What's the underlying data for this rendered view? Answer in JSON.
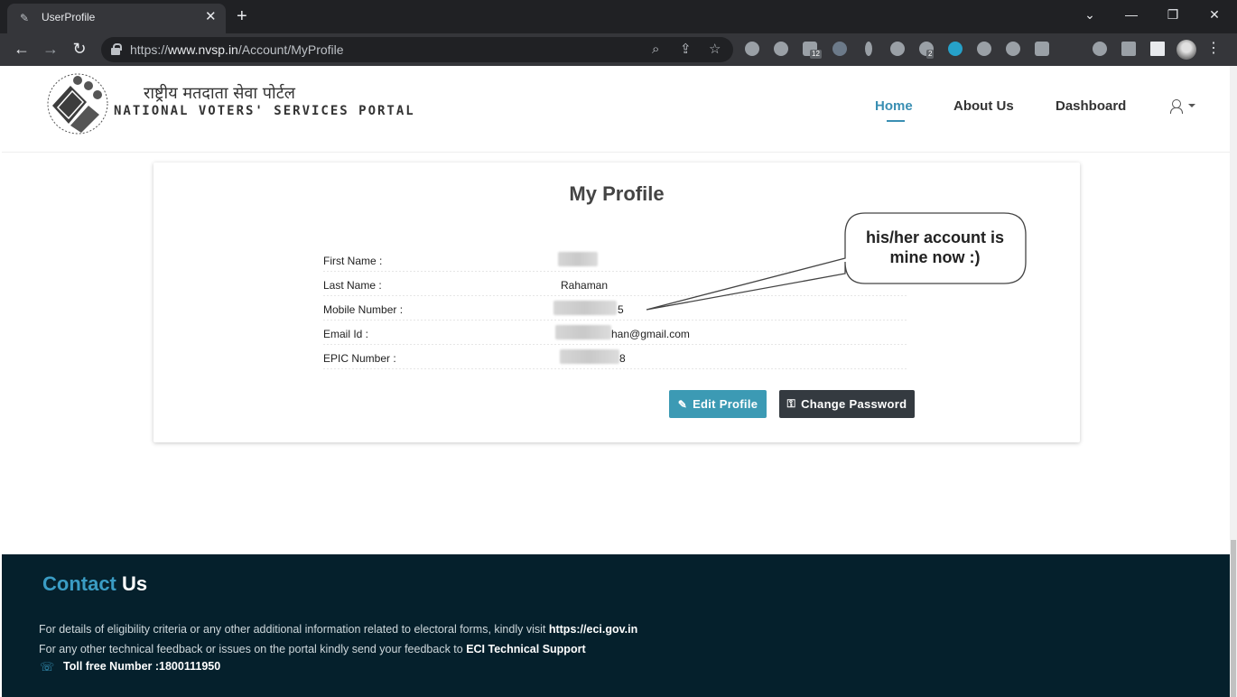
{
  "browser": {
    "tab_title": "UserProfile",
    "tab_close": "✕",
    "new_tab": "+",
    "url_scheme": "https://",
    "url_host": "www.nvsp.in",
    "url_path": "/Account/MyProfile",
    "window_controls": {
      "minimize": "—",
      "restore": "❐",
      "close": "✕",
      "tab_search": "⌄"
    },
    "ext_badges": {
      "b1": "12",
      "b2": "2"
    }
  },
  "site": {
    "logo_hindi": "राष्ट्रीय मतदाता सेवा पोर्टल",
    "logo_english": "NATIONAL VOTERS' SERVICES PORTAL",
    "nav": {
      "home": "Home",
      "about": "About Us",
      "dashboard": "Dashboard"
    },
    "colors": {
      "accent": "#3a8fb3",
      "footer_bg": "#05202c",
      "edit_btn": "#3c9ab4",
      "pass_btn": "#343a40"
    }
  },
  "profile": {
    "title": "My Profile",
    "fields": [
      {
        "label": "First Name :",
        "value": ""
      },
      {
        "label": "Last Name :",
        "value": "Rahaman"
      },
      {
        "label": "Mobile Number :",
        "value": "5"
      },
      {
        "label": "Email Id :",
        "value": "han@gmail.com"
      },
      {
        "label": "EPIC Number :",
        "value": "8"
      }
    ],
    "edit_button": "Edit Profile",
    "password_button": "Change Password"
  },
  "annotation": {
    "line1": "his/her account is",
    "line2": "mine now :)"
  },
  "footer": {
    "contact_word1": "Contact",
    "contact_word2": "Us",
    "line1_text": "For details of eligibility criteria or any other additional information related to electoral forms, kindly visit ",
    "line1_link": "https://eci.gov.in",
    "line2_text": "For any other technical feedback or issues on the portal kindly send your feedback to ",
    "line2_link": "ECI Technical Support",
    "tollfree": "Toll free Number :1800111950"
  }
}
